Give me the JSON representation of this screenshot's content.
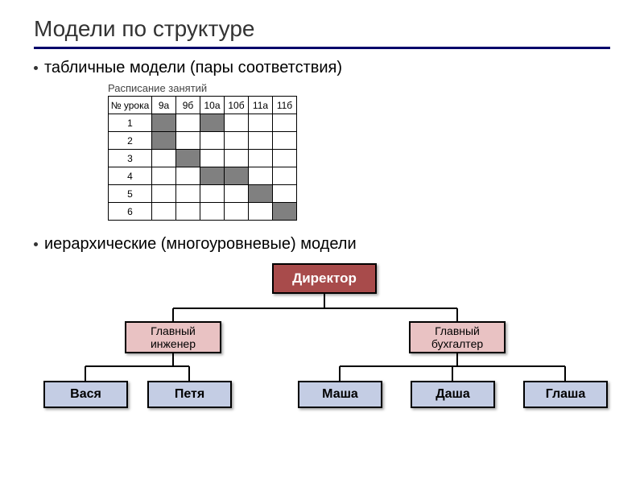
{
  "title": "Модели по структуре",
  "bullets": {
    "tabular": "табличные модели (пары соответствия)",
    "hierarchical": "иерархические (многоуровневые) модели"
  },
  "schedule": {
    "caption": "Расписание занятий",
    "row_header": "№ урока",
    "columns": [
      "9а",
      "9б",
      "10а",
      "10б",
      "11а",
      "11б"
    ],
    "rows": [
      "1",
      "2",
      "3",
      "4",
      "5",
      "6"
    ],
    "filled": [
      [
        1,
        0,
        1,
        0,
        0,
        0
      ],
      [
        1,
        0,
        0,
        0,
        0,
        0
      ],
      [
        0,
        1,
        0,
        0,
        0,
        0
      ],
      [
        0,
        0,
        1,
        1,
        0,
        0
      ],
      [
        0,
        0,
        0,
        0,
        1,
        0
      ],
      [
        0,
        0,
        0,
        0,
        0,
        1
      ]
    ]
  },
  "hierarchy": {
    "root": "Директор",
    "chiefs": {
      "engineer": "Главный\nинженер",
      "accountant": "Главный\nбухгалтер"
    },
    "leaves": {
      "l1": "Вася",
      "l2": "Петя",
      "l3": "Маша",
      "l4": "Даша",
      "l5": "Глаша"
    }
  }
}
